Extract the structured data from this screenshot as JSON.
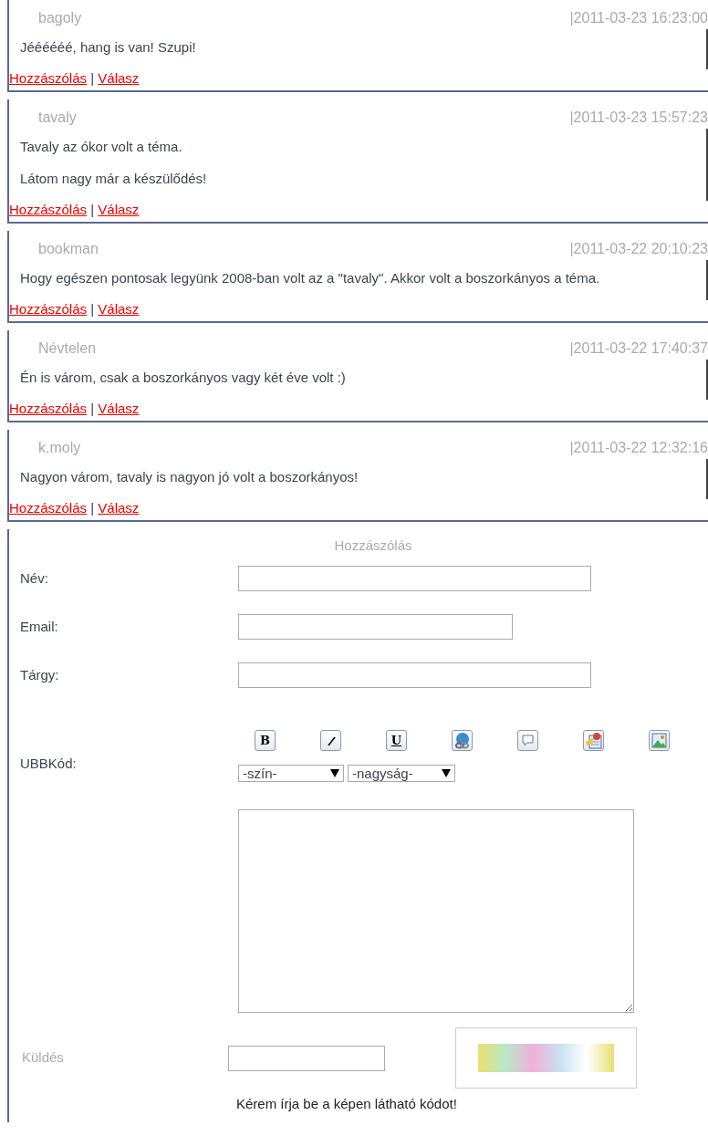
{
  "link_separator": "|",
  "comments": [
    {
      "author": "bagoly",
      "date": "|2011-03-23 16:23:00",
      "paragraphs": [
        "Jéééééé, hang is van! Szupi!"
      ],
      "actions": [
        "Hozzászólás",
        "Válasz"
      ]
    },
    {
      "author": "tavaly",
      "date": "|2011-03-23 15:57:23",
      "paragraphs": [
        "Tavaly az ókor volt a téma.",
        "Látom nagy már a készülődés!"
      ],
      "actions": [
        "Hozzászólás",
        "Válasz"
      ]
    },
    {
      "author": "bookman",
      "date": "|2011-03-22 20:10:23",
      "paragraphs": [
        "Hogy egészen pontosak legyünk 2008-ban volt az a \"tavaly\". Akkor volt a boszorkányos a téma."
      ],
      "actions": [
        "Hozzászólás",
        "Válasz"
      ]
    },
    {
      "author": "Névtelen",
      "date": "|2011-03-22 17:40:37",
      "paragraphs": [
        "Én is várom, csak a boszorkányos vagy két éve volt :)"
      ],
      "actions": [
        "Hozzászólás",
        "Válasz"
      ]
    },
    {
      "author": "k.moly",
      "date": "|2011-03-22 12:32:16",
      "paragraphs": [
        "Nagyon várom, tavaly is nagyon jó volt a boszorkányos!"
      ],
      "actions": [
        "Hozzászólás",
        "Válasz"
      ]
    }
  ],
  "form": {
    "title": "Hozzászólás",
    "fields": [
      {
        "label": "Név:"
      },
      {
        "label": "Email:"
      },
      {
        "label": "Tárgy:"
      }
    ],
    "ubb_label": "UBBKód:",
    "toolbar": [
      {
        "kind": "bold",
        "label": "B"
      },
      {
        "kind": "italic"
      },
      {
        "kind": "underline",
        "label": "U"
      },
      {
        "kind": "link"
      },
      {
        "kind": "quote"
      },
      {
        "kind": "email"
      },
      {
        "kind": "image"
      }
    ],
    "selects": [
      {
        "value": "-szín-"
      },
      {
        "value": "-nagyság-"
      }
    ],
    "submit": "Küldés",
    "captcha_hint": "Kérem írja be a képen látható kódot!"
  }
}
